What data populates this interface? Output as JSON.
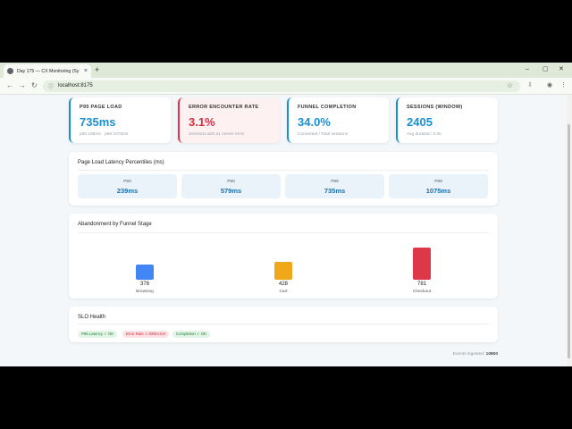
{
  "browser": {
    "tab_title": "Day 175 — CX Monitoring (Sy",
    "url": "localhost:8175"
  },
  "kpis": [
    {
      "label": "P95 PAGE LOAD",
      "value": "735ms",
      "sub": "p50 239ms · p99 1075ms"
    },
    {
      "label": "ERROR ENCOUNTER RATE",
      "value": "3.1%",
      "sub": "Sessions with ≥1 server error"
    },
    {
      "label": "FUNNEL COMPLETION",
      "value": "34.0%",
      "sub": "Converted / Total sessions"
    },
    {
      "label": "SESSIONS (WINDOW)",
      "value": "2405",
      "sub": "Avg duration: 0.0s"
    }
  ],
  "latency": {
    "title": "Page Load Latency Percentiles (ms)",
    "items": [
      {
        "label": "P50",
        "value": "239ms"
      },
      {
        "label": "P90",
        "value": "579ms"
      },
      {
        "label": "P95",
        "value": "735ms"
      },
      {
        "label": "P99",
        "value": "1075ms"
      }
    ]
  },
  "abandonment": {
    "title": "Abandonment by Funnel Stage"
  },
  "chart_data": {
    "type": "bar",
    "categories": [
      "Browsing",
      "Cart",
      "Checkout"
    ],
    "values": [
      378,
      428,
      781
    ],
    "colors": [
      "#4285f4",
      "#f0a81a",
      "#dc3848"
    ]
  },
  "slo": {
    "title": "SLO Health",
    "badges": [
      {
        "text": "P95 Latency ✓ OK",
        "status": "ok"
      },
      {
        "text": "Error Rate ⚠ BREACH",
        "status": "breach"
      },
      {
        "text": "Completion ✓ OK",
        "status": "ok"
      }
    ]
  },
  "footer": {
    "label": "Events ingested:",
    "count": "10800"
  }
}
